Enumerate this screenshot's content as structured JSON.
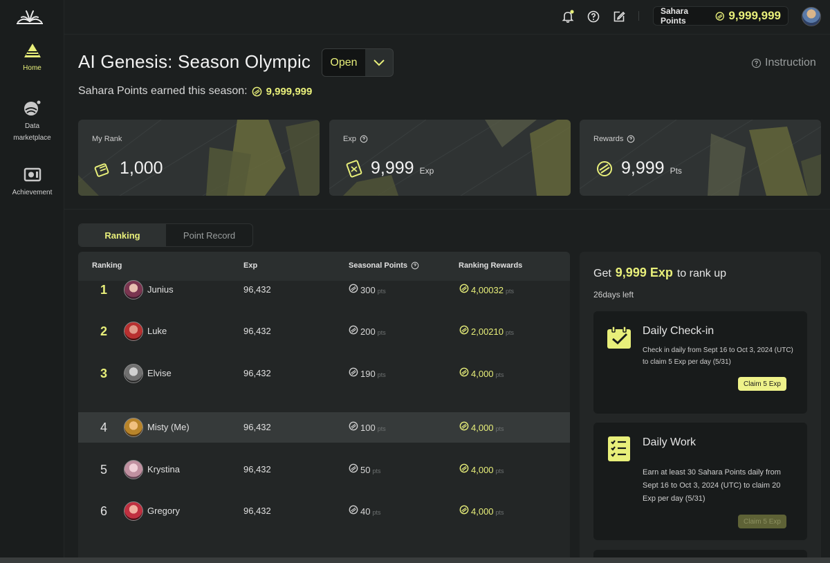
{
  "sidebar": {
    "items": [
      {
        "label": "Home",
        "icon": "home-pyramid-icon",
        "active": true
      },
      {
        "label": "Data\nmarketplace",
        "icon": "data-marketplace-icon",
        "active": false
      },
      {
        "label": "Achievement",
        "icon": "achievement-icon",
        "active": false
      }
    ]
  },
  "topbar": {
    "points_label": "Sahara Points",
    "points_value": "9,999,999",
    "icons": [
      "bell-icon",
      "help-icon",
      "edit-icon"
    ]
  },
  "header": {
    "title": "AI Genesis: Season Olympic",
    "status": "Open",
    "instruction": "Instruction",
    "season_points_label": "Sahara Points earned this season:",
    "season_points_value": "9,999,999"
  },
  "stats": [
    {
      "label": "My Rank",
      "value": "1,000",
      "unit": ""
    },
    {
      "label": "Exp",
      "value": "9,999",
      "unit": "Exp"
    },
    {
      "label": "Rewards",
      "value": "9,999",
      "unit": "Pts"
    }
  ],
  "tabs": [
    {
      "label": "Ranking",
      "active": true
    },
    {
      "label": "Point Record",
      "active": false
    }
  ],
  "table": {
    "headers": {
      "ranking": "Ranking",
      "exp": "Exp",
      "seasonal_points": "Seasonal Points",
      "ranking_rewards": "Ranking Rewards"
    },
    "rows": [
      {
        "rank": "1",
        "name": "Junius",
        "exp": "96,432",
        "points": "300",
        "points_unit": "pts",
        "reward": "4,00032",
        "reward_unit": "pts"
      },
      {
        "rank": "2",
        "name": "Luke",
        "exp": "96,432",
        "points": "200",
        "points_unit": "pts",
        "reward": "2,00210",
        "reward_unit": "pts"
      },
      {
        "rank": "3",
        "name": "Elvise",
        "exp": "96,432",
        "points": "190",
        "points_unit": "pts",
        "reward": "4,000",
        "reward_unit": "pts"
      },
      {
        "rank": "4",
        "name": "Misty (Me)",
        "exp": "96,432",
        "points": "100",
        "points_unit": "pts",
        "reward": "4,000",
        "reward_unit": "pts"
      },
      {
        "rank": "5",
        "name": "Krystina",
        "exp": "96,432",
        "points": "50",
        "points_unit": "pts",
        "reward": "4,000",
        "reward_unit": "pts"
      },
      {
        "rank": "6",
        "name": "Gregory",
        "exp": "96,432",
        "points": "40",
        "points_unit": "pts",
        "reward": "4,000",
        "reward_unit": "pts"
      }
    ]
  },
  "side_panel": {
    "rankup_prefix": "Get",
    "rankup_value": "9,999 Exp",
    "rankup_suffix": "to rank up",
    "days_left": "26days left",
    "tasks": [
      {
        "title": "Daily Check-in",
        "desc_1": "Check in daily from Sept 16  to Oct 3, 2024 (UTC)",
        "desc_2": "to claim 5 Exp per day (5/31)",
        "button": "Claim 5 Exp",
        "enabled": true
      },
      {
        "title": "Daily Work",
        "desc_1": "Earn at least 30 Sahara Points daily from",
        "desc_2": "Sept 16  to Oct 3, 2024 (UTC) to claim 20",
        "desc_3": "Exp per day (5/31)",
        "button": "Claim 5 Exp",
        "enabled": false
      }
    ]
  },
  "colors": {
    "accent": "#e8ef7a",
    "background": "#1c1f1f",
    "card": "#2f3333"
  }
}
